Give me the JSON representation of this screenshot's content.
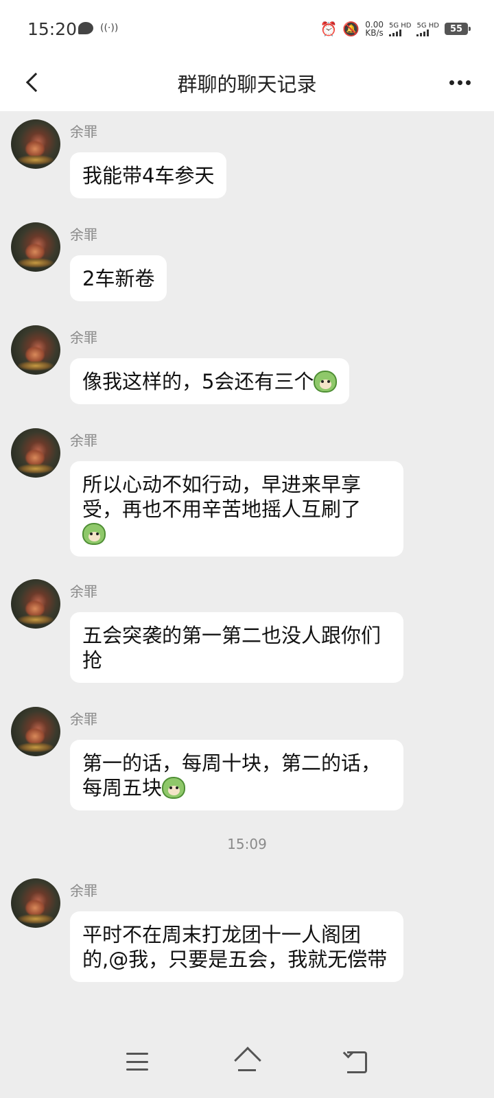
{
  "status_bar": {
    "time": "15:20",
    "speed_value": "0.00",
    "speed_unit": "KB/s",
    "sim1_label": "5G HD",
    "sim2_label": "5G HD",
    "battery": "55",
    "icons": [
      "message-bubble-icon",
      "nfc-icon",
      "alarm-icon",
      "mute-icon",
      "signal-icon",
      "battery-icon"
    ]
  },
  "header": {
    "title": "群聊的聊天记录",
    "back_icon": "chevron-left-icon",
    "more_icon": "ellipsis-icon"
  },
  "messages": [
    {
      "sender": "余罪",
      "text": "我能带4车参天",
      "emoji": false
    },
    {
      "sender": "余罪",
      "text": "2车新卷",
      "emoji": false
    },
    {
      "sender": "余罪",
      "text": "像我这样的，5会还有三个",
      "emoji": true
    },
    {
      "sender": "余罪",
      "text": "所以心动不如行动，早进来早享受，再也不用辛苦地摇人互刷了",
      "emoji": true
    },
    {
      "sender": "余罪",
      "text": "五会突袭的第一第二也没人跟你们抢",
      "emoji": false
    },
    {
      "sender": "余罪",
      "text": "第一的话，每周十块，第二的话，每周五块",
      "emoji": true
    },
    {
      "sender": "余罪",
      "text": "平时不在周末打龙团十一人阁团的,@我，只要是五会，我就无偿带",
      "emoji": false
    }
  ],
  "time_divider": "15:09",
  "nav_bar": {
    "icons": [
      "menu-icon",
      "home-icon",
      "back-icon"
    ]
  }
}
